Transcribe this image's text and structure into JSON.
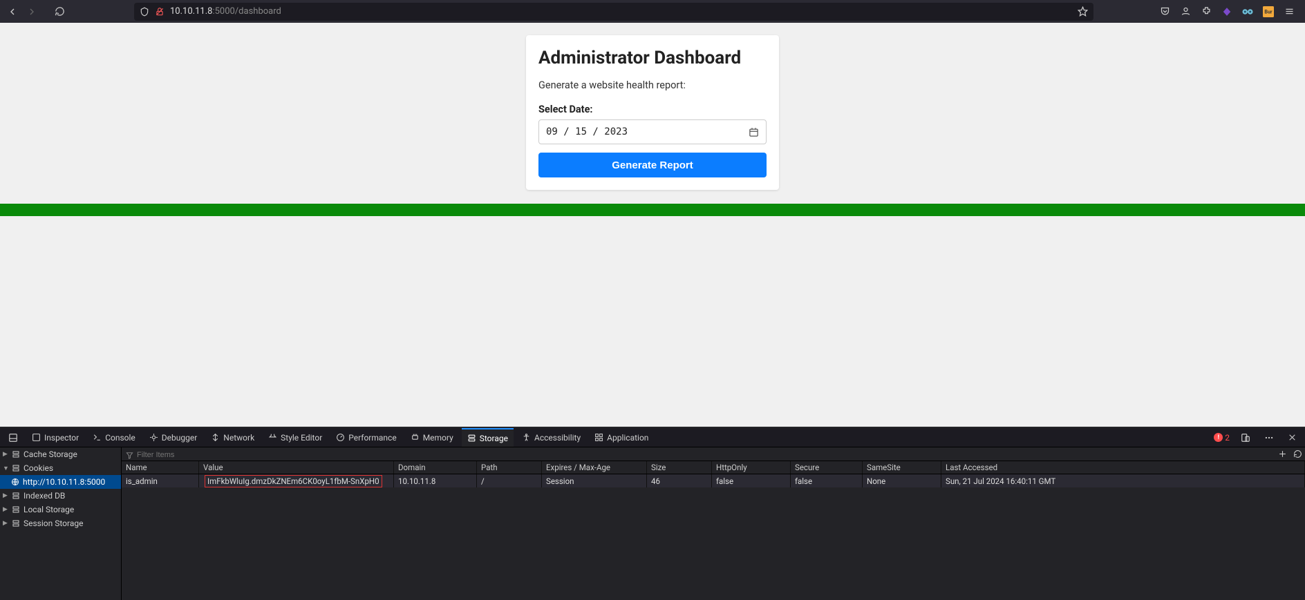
{
  "url": {
    "host": "10.10.11.8",
    "rest": ":5000/dashboard"
  },
  "page": {
    "title": "Administrator Dashboard",
    "subtitle": "Generate a website health report:",
    "date_label": "Select Date:",
    "date_value": "09 / 15 / 2023",
    "button": "Generate Report"
  },
  "devtools": {
    "tabs": {
      "inspector": "Inspector",
      "console": "Console",
      "debugger": "Debugger",
      "network": "Network",
      "style": "Style Editor",
      "performance": "Performance",
      "memory": "Memory",
      "storage": "Storage",
      "accessibility": "Accessibility",
      "application": "Application"
    },
    "errors": "2",
    "sidebar": {
      "cache": "Cache Storage",
      "cookies": "Cookies",
      "cookie_host": "http://10.10.11.8:5000",
      "indexed": "Indexed DB",
      "local": "Local Storage",
      "session": "Session Storage"
    },
    "filter_placeholder": "Filter Items",
    "columns": {
      "name": "Name",
      "value": "Value",
      "domain": "Domain",
      "path": "Path",
      "expires": "Expires / Max-Age",
      "size": "Size",
      "httponly": "HttpOnly",
      "secure": "Secure",
      "samesite": "SameSite",
      "last": "Last Accessed"
    },
    "row": {
      "name": "is_admin",
      "value": "ImFkbWluIg.dmzDkZNEm6CK0oyL1fbM-SnXpH0",
      "domain": "10.10.11.8",
      "path": "/",
      "expires": "Session",
      "size": "46",
      "httponly": "false",
      "secure": "false",
      "samesite": "None",
      "last": "Sun, 21 Jul 2024 16:40:11 GMT"
    }
  }
}
